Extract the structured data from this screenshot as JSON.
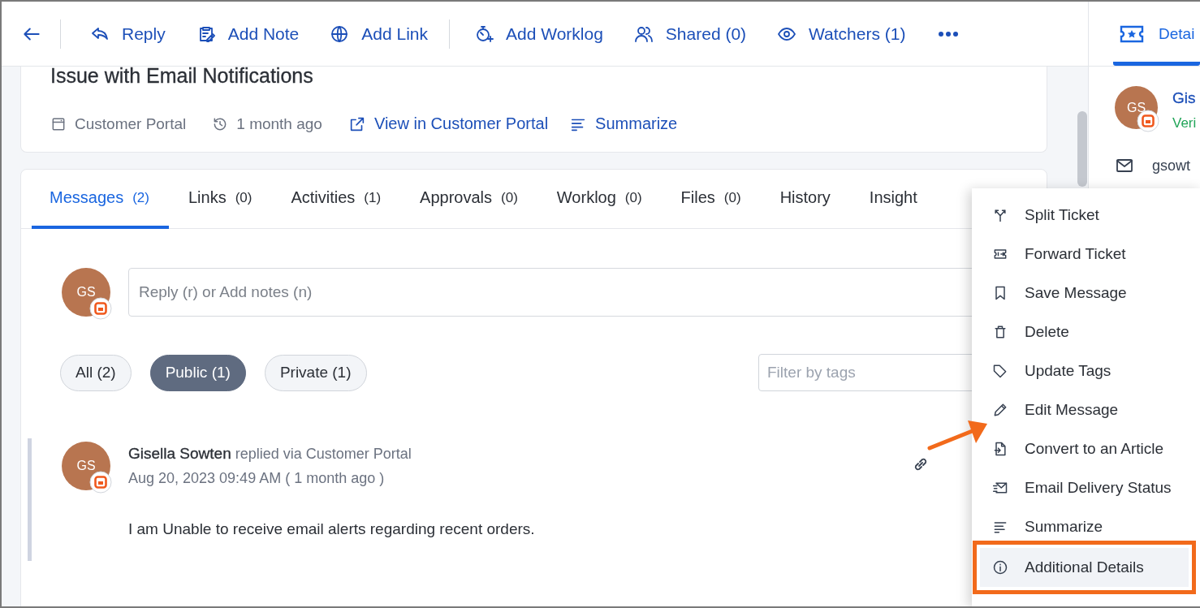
{
  "toolbar": {
    "back": true,
    "actions": [
      {
        "label": "Reply",
        "kind": "reply",
        "divider_after": false
      },
      {
        "label": "Add Note",
        "kind": "note",
        "divider_after": false
      },
      {
        "label": "Add Link",
        "kind": "globe",
        "divider_after": true
      },
      {
        "label": "Add Worklog",
        "kind": "timer",
        "divider_after": false
      },
      {
        "label": "Shared (0)",
        "kind": "users",
        "divider_after": false
      },
      {
        "label": "Watchers (1)",
        "kind": "eye",
        "divider_after": false
      }
    ],
    "more": true
  },
  "ticket": {
    "title": "Issue with Email Notifications",
    "source": "Customer Portal",
    "age": "1 month ago",
    "links": [
      {
        "label": "View in Customer Portal",
        "kind": "external"
      },
      {
        "label": "Summarize",
        "kind": "summarize"
      }
    ]
  },
  "tabs": [
    {
      "label": "Messages",
      "count": "(2)",
      "selected": true
    },
    {
      "label": "Links",
      "count": "(0)",
      "selected": false
    },
    {
      "label": "Activities",
      "count": "(1)",
      "selected": false
    },
    {
      "label": "Approvals",
      "count": "(0)",
      "selected": false
    },
    {
      "label": "Worklog",
      "count": "(0)",
      "selected": false
    },
    {
      "label": "Files",
      "count": "(0)",
      "selected": false
    },
    {
      "label": "History",
      "selected": false
    },
    {
      "label": "Insight",
      "selected": false
    }
  ],
  "composer": {
    "avatar": "GS",
    "placeholder": "Reply (r) or Add notes (n)"
  },
  "filters": [
    {
      "label": "All (2)",
      "selected": false
    },
    {
      "label": "Public (1)",
      "selected": true
    },
    {
      "label": "Private (1)",
      "selected": false
    }
  ],
  "tag_filter": {
    "placeholder": "Filter by tags"
  },
  "message": {
    "avatar": "GS",
    "author": "Gisella Sowten",
    "via": "replied via Customer Portal",
    "time": "Aug 20, 2023 09:49 AM ( 1 month ago )",
    "body": "I am Unable to receive email alerts regarding recent orders."
  },
  "side_panel": {
    "tab": {
      "label": "Detai",
      "selected": true
    },
    "contact": {
      "avatar": "GS",
      "name": "Gis",
      "status": "Veri",
      "email": "gsowt"
    }
  },
  "menu": {
    "callout_arrow": true,
    "items": [
      {
        "label": "Split Ticket",
        "kind": "split",
        "highlighted": false
      },
      {
        "label": "Forward Ticket",
        "kind": "forward",
        "highlighted": false
      },
      {
        "label": "Save Message",
        "kind": "bookmark",
        "highlighted": false
      },
      {
        "label": "Delete",
        "kind": "trash",
        "highlighted": false
      },
      {
        "label": "Update Tags",
        "kind": "tag",
        "highlighted": false
      },
      {
        "label": "Edit Message",
        "kind": "pencil",
        "highlighted": false
      },
      {
        "label": "Convert to an Article",
        "kind": "convert",
        "highlighted": false
      },
      {
        "label": "Email Delivery Status",
        "kind": "mail-send",
        "highlighted": false
      },
      {
        "label": "Summarize",
        "kind": "summarize",
        "highlighted": false
      },
      {
        "label": "Additional Details",
        "kind": "info",
        "highlighted": true
      }
    ]
  }
}
